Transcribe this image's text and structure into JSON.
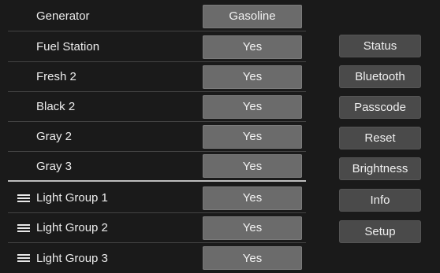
{
  "rows": [
    {
      "label": "Generator",
      "value": "Gasoline"
    },
    {
      "label": "Fuel Station",
      "value": "Yes"
    },
    {
      "label": "Fresh 2",
      "value": "Yes"
    },
    {
      "label": "Black 2",
      "value": "Yes"
    },
    {
      "label": "Gray 2",
      "value": "Yes"
    },
    {
      "label": "Gray 3",
      "value": "Yes"
    },
    {
      "label": "Light Group 1",
      "value": "Yes",
      "icon": "menu-icon"
    },
    {
      "label": "Light Group 2",
      "value": "Yes",
      "icon": "menu-icon"
    },
    {
      "label": "Light Group 3",
      "value": "Yes",
      "icon": "menu-icon"
    }
  ],
  "sidebar": {
    "buttons": [
      "Status",
      "Bluetooth",
      "Passcode",
      "Reset",
      "Brightness",
      "Info",
      "Setup"
    ]
  },
  "colors": {
    "background": "#1a1a1a",
    "value_button": "#6b6b6b",
    "side_button": "#4a4a4a",
    "divider": "#bdbdbd"
  }
}
